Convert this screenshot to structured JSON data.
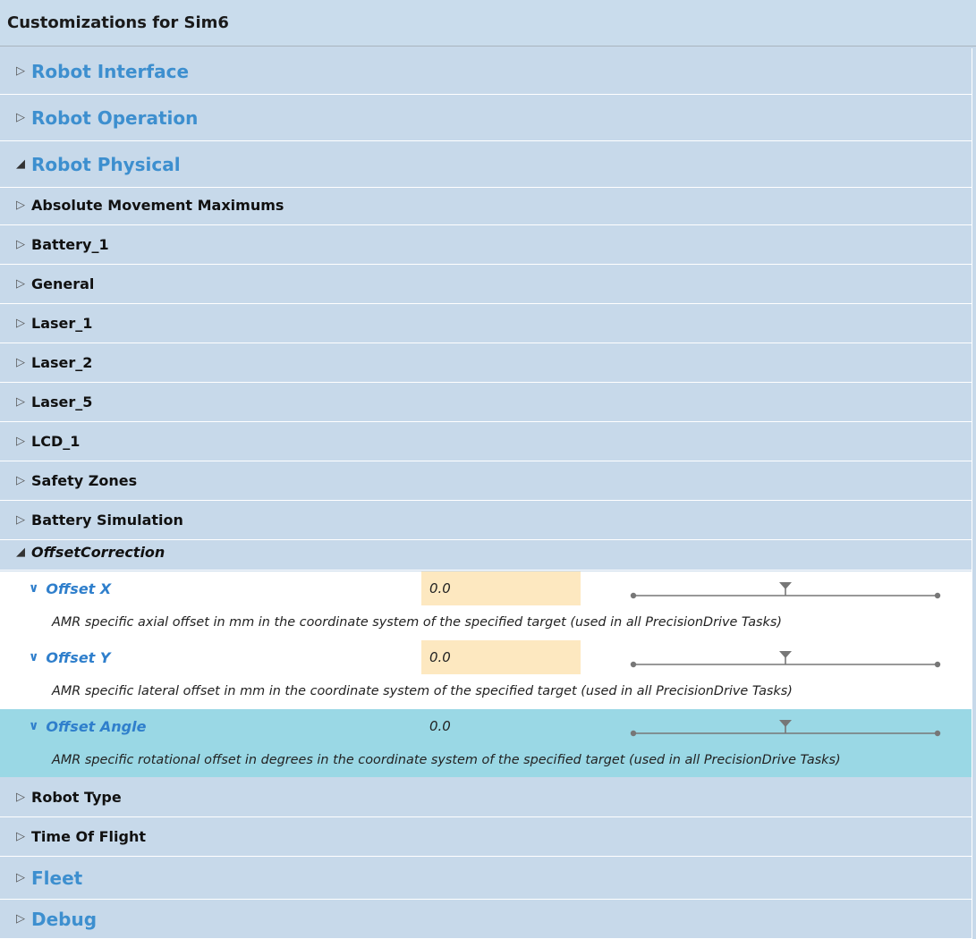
{
  "panel": {
    "title": "Customizations for Sim6"
  },
  "sections": {
    "robot_interface": "Robot Interface",
    "robot_operation": "Robot Operation",
    "robot_physical": "Robot Physical",
    "fleet": "Fleet",
    "debug": "Debug"
  },
  "groups": {
    "absolute_movement_maximums": "Absolute Movement Maximums",
    "battery_1": "Battery_1",
    "general": "General",
    "laser_1": "Laser_1",
    "laser_2": "Laser_2",
    "laser_5": "Laser_5",
    "lcd_1": "LCD_1",
    "safety_zones": "Safety Zones",
    "battery_simulation": "Battery Simulation",
    "offset_correction": "OffsetCorrection",
    "robot_type": "Robot Type",
    "time_of_flight": "Time Of Flight"
  },
  "properties": [
    {
      "name": "Offset X",
      "value": "0.0",
      "slider_position": 0.5,
      "description": "AMR specific axial offset in mm in the coordinate system of the specified target (used in all PrecisionDrive Tasks)"
    },
    {
      "name": "Offset Y",
      "value": "0.0",
      "slider_position": 0.5,
      "description": "AMR specific lateral offset in mm in the coordinate system of the specified target (used in all PrecisionDrive Tasks)"
    },
    {
      "name": "Offset Angle",
      "value": "0.0",
      "slider_position": 0.5,
      "description": "AMR specific rotational offset in degrees in the coordinate system of the specified target (used in all PrecisionDrive Tasks)"
    }
  ],
  "icons": {
    "collapsed": "triangle-right-outline-icon",
    "expanded": "triangle-down-filled-icon",
    "property": "chevron-down-icon"
  },
  "colors": {
    "panel_bg": "#c7d9ea",
    "section_text": "#3d8fcf",
    "property_text": "#2f7fcc",
    "value_bg": "#fde8c0",
    "selected_row": "#9ad8e5"
  }
}
